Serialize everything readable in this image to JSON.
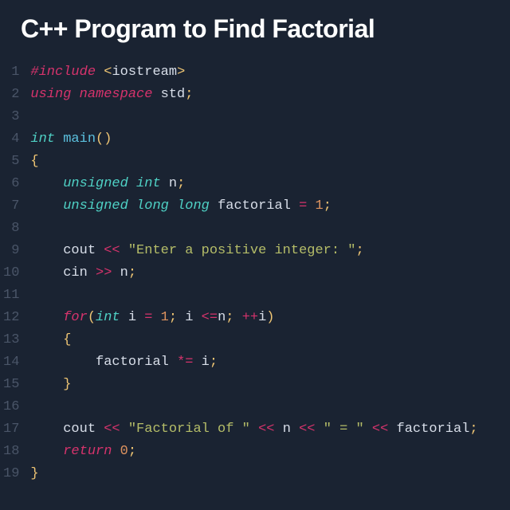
{
  "title": "C++ Program to Find Factorial",
  "lineNumbers": [
    "1",
    "2",
    "3",
    "4",
    "5",
    "6",
    "7",
    "8",
    "9",
    "10",
    "11",
    "12",
    "13",
    "14",
    "15",
    "16",
    "17",
    "18",
    "19"
  ],
  "code": {
    "l1": {
      "include": "#include",
      "lt": "<",
      "lib": "iostream",
      "gt": ">"
    },
    "l2": {
      "using": "using",
      "namespace": "namespace",
      "std": "std",
      "semi": ";"
    },
    "l4": {
      "int": "int",
      "main": "main",
      "paren": "()"
    },
    "l5": {
      "brace": "{"
    },
    "l6": {
      "indent": "    ",
      "unsigned": "unsigned",
      "int": "int",
      "n": "n",
      "semi": ";"
    },
    "l7": {
      "indent": "    ",
      "unsigned": "unsigned",
      "long1": "long",
      "long2": "long",
      "var": "factorial",
      "eq": "=",
      "one": "1",
      "semi": ";"
    },
    "l9": {
      "indent": "    ",
      "cout": "cout",
      "op": "<<",
      "str": "\"Enter a positive integer: \"",
      "semi": ";"
    },
    "l10": {
      "indent": "    ",
      "cin": "cin",
      "op": ">>",
      "n": "n",
      "semi": ";"
    },
    "l12": {
      "indent": "    ",
      "for": "for",
      "lp": "(",
      "int": "int",
      "i": "i",
      "eq": "=",
      "one": "1",
      "semi1": ";",
      "i2": "i",
      "lte": "<=",
      "n": "n",
      "semi2": ";",
      "inc": "++",
      "i3": "i",
      "rp": ")"
    },
    "l13": {
      "indent": "    ",
      "brace": "{"
    },
    "l14": {
      "indent": "        ",
      "var": "factorial",
      "op": "*=",
      "i": "i",
      "semi": ";"
    },
    "l15": {
      "indent": "    ",
      "brace": "}"
    },
    "l17": {
      "indent": "    ",
      "cout": "cout",
      "op1": "<<",
      "str1": "\"Factorial of \"",
      "op2": "<<",
      "n": "n",
      "op3": "<<",
      "str2": "\" = \"",
      "op4": "<<",
      "var": "factorial",
      "semi": ";"
    },
    "l18": {
      "indent": "    ",
      "return": "return",
      "zero": "0",
      "semi": ";"
    },
    "l19": {
      "brace": "}"
    }
  }
}
